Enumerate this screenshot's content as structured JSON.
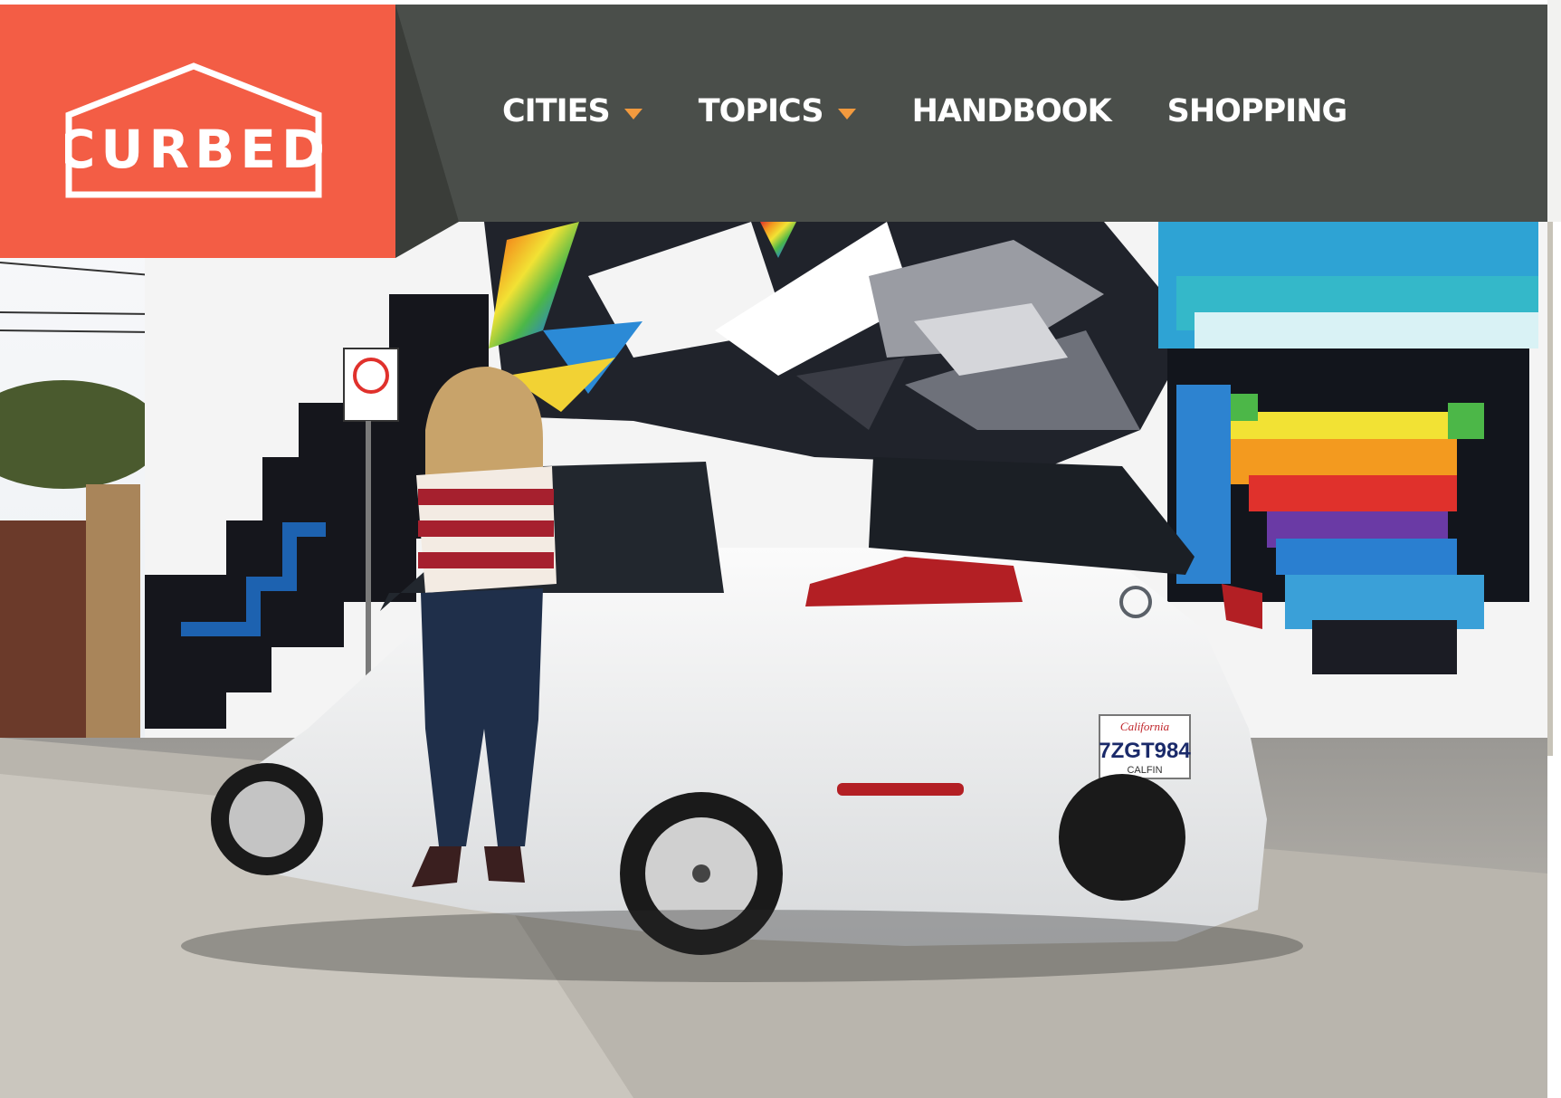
{
  "brand": {
    "logo_text": "CURBED",
    "color": "#f35d45",
    "header_bg": "#4a4e4a",
    "caret_color": "#f29a3e"
  },
  "nav": {
    "items": [
      {
        "label": "CITIES",
        "has_dropdown": true
      },
      {
        "label": "TOPICS",
        "has_dropdown": true
      },
      {
        "label": "HANDBOOK",
        "has_dropdown": false
      },
      {
        "label": "SHOPPING",
        "has_dropdown": false
      }
    ]
  },
  "hero": {
    "plate_text": "7ZGT984",
    "plate_state": "California",
    "plate_bottom": "CALFIN"
  }
}
